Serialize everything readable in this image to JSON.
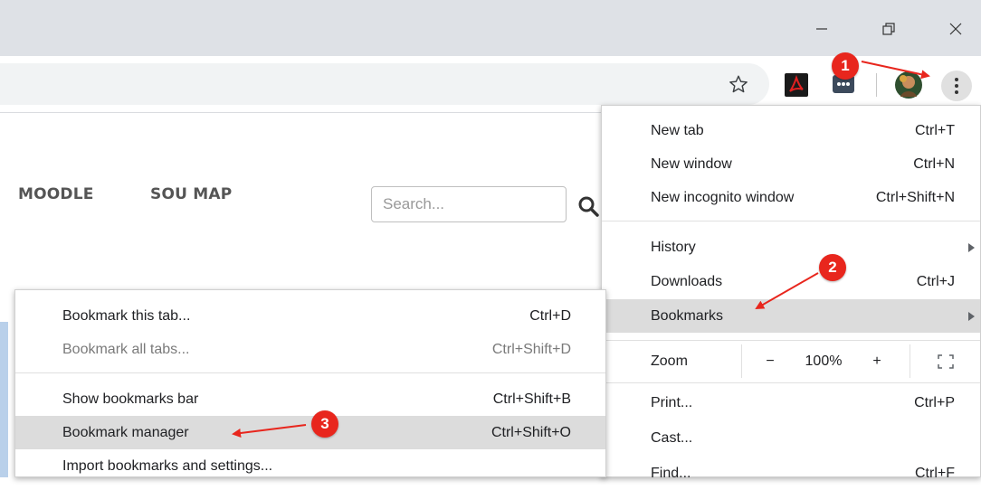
{
  "window_controls": {
    "minimize_icon": "minimize-icon",
    "restore_icon": "restore-icon",
    "close_icon": "close-icon"
  },
  "toolbar": {
    "icons": [
      "star-icon",
      "adobe-pdf-extension-icon",
      "chat-extension-icon",
      "profile-avatar",
      "kebab-menu-icon"
    ]
  },
  "page": {
    "nav": [
      "MOODLE",
      "SOU MAP"
    ],
    "search_placeholder": "Search..."
  },
  "main_menu": {
    "items": [
      {
        "label": "New tab",
        "shortcut": "Ctrl+T"
      },
      {
        "label": "New window",
        "shortcut": "Ctrl+N"
      },
      {
        "label": "New incognito window",
        "shortcut": "Ctrl+Shift+N"
      },
      {
        "label": "History",
        "shortcut": ""
      },
      {
        "label": "Downloads",
        "shortcut": "Ctrl+J"
      },
      {
        "label": "Bookmarks",
        "shortcut": ""
      },
      {
        "label": "Zoom",
        "shortcut": ""
      },
      {
        "label": "Print...",
        "shortcut": "Ctrl+P"
      },
      {
        "label": "Cast...",
        "shortcut": ""
      },
      {
        "label": "Find...",
        "shortcut": "Ctrl+F"
      }
    ],
    "zoom": {
      "minus": "−",
      "value": "100%",
      "plus": "+"
    }
  },
  "bookmarks_submenu": {
    "items": [
      {
        "label": "Bookmark this tab...",
        "shortcut": "Ctrl+D"
      },
      {
        "label": "Bookmark all tabs...",
        "shortcut": "Ctrl+Shift+D"
      },
      {
        "label": "Show bookmarks bar",
        "shortcut": "Ctrl+Shift+B"
      },
      {
        "label": "Bookmark manager",
        "shortcut": "Ctrl+Shift+O"
      },
      {
        "label": "Import bookmarks and settings...",
        "shortcut": ""
      }
    ]
  },
  "annotations": {
    "badges": [
      "1",
      "2",
      "3"
    ],
    "color": "#e8261d"
  },
  "colors": {
    "titlebar": "#dee1e6",
    "highlight": "#dcdcdc",
    "dimmed_text": "#7a7a7a"
  }
}
